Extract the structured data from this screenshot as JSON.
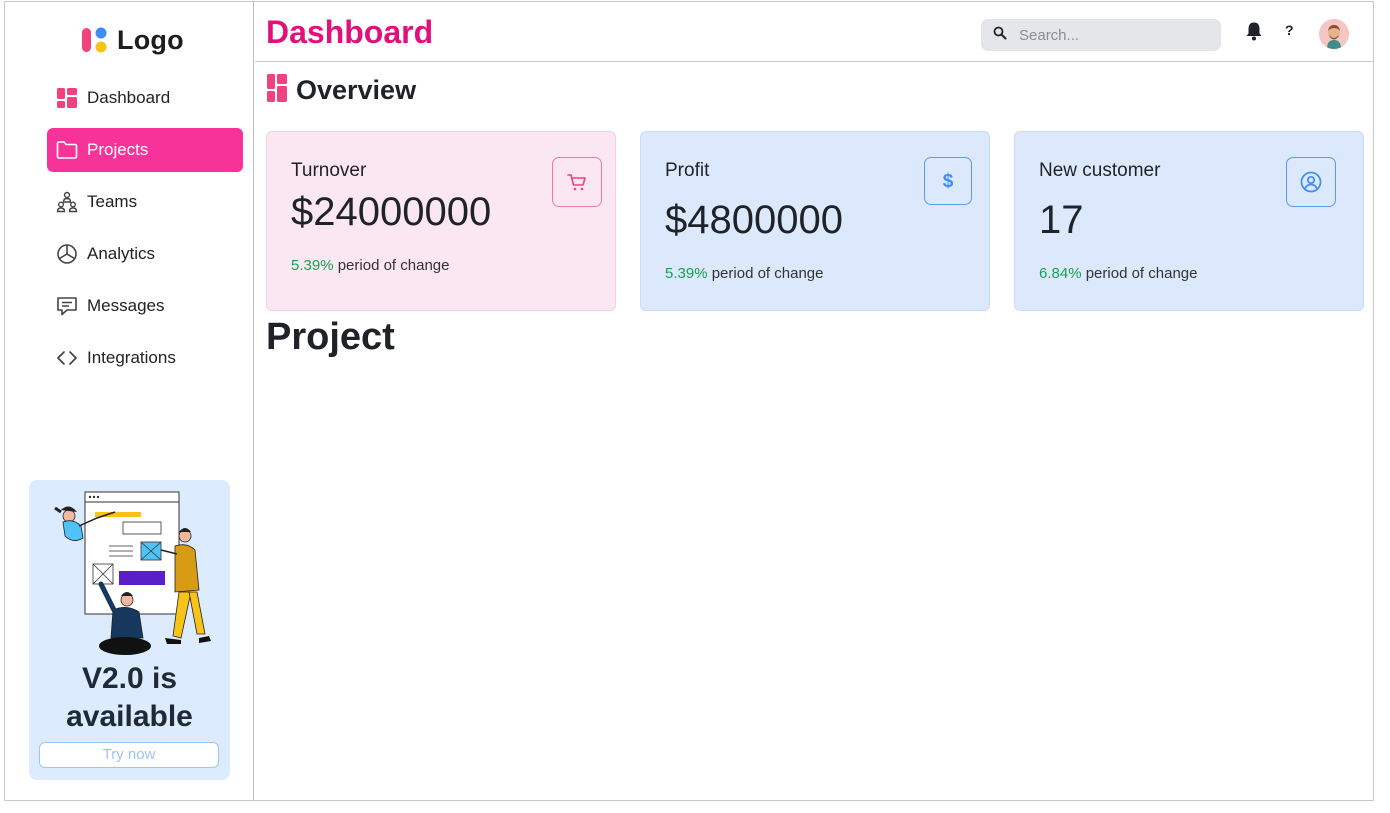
{
  "sidebar": {
    "logo_text": "Logo",
    "items": [
      {
        "label": "Dashboard",
        "icon": "dashboard-icon"
      },
      {
        "label": "Projects",
        "icon": "folder-icon",
        "active": true
      },
      {
        "label": "Teams",
        "icon": "teams-icon"
      },
      {
        "label": "Analytics",
        "icon": "pie-chart-icon"
      },
      {
        "label": "Messages",
        "icon": "message-icon"
      },
      {
        "label": "Integrations",
        "icon": "code-icon"
      }
    ],
    "promo": {
      "title": "V2.0 is available",
      "button_label": "Try now"
    }
  },
  "header": {
    "title": "Dashboard",
    "search_placeholder": "Search...",
    "help_label": "?"
  },
  "overview": {
    "title": "Overview",
    "cards": [
      {
        "title": "Turnover",
        "value": "$24000000",
        "change_pct": "5.39%",
        "change_text": " period of change",
        "icon": "cart-icon"
      },
      {
        "title": "Profit",
        "value": "$4800000",
        "change_pct": "5.39%",
        "change_text": " period of change",
        "icon": "dollar-icon"
      },
      {
        "title": "New customer",
        "value": "17",
        "change_pct": "6.84%",
        "change_text": " period of change",
        "icon": "user-circle-icon"
      }
    ]
  },
  "project": {
    "title": "Project"
  },
  "colors": {
    "brand": "#e0117a",
    "active_nav": "#f7339a",
    "positive": "#1aa052",
    "card_pink": "#fbe7f1",
    "card_blue": "#dce9fc"
  }
}
